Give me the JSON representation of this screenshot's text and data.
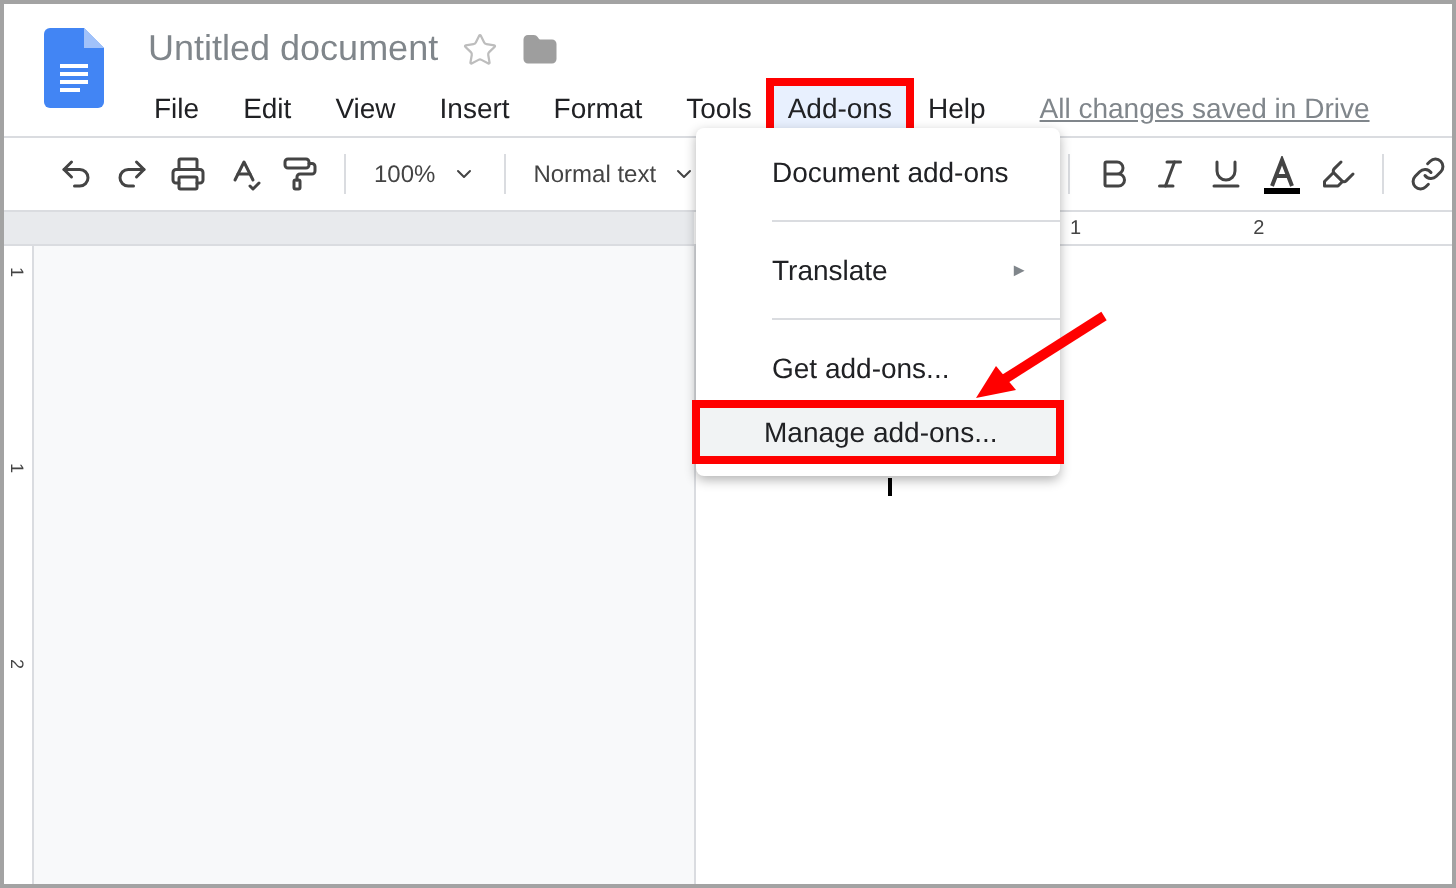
{
  "document": {
    "title": "Untitled document",
    "starred": false
  },
  "menu_bar": [
    {
      "label": "File",
      "selected": false,
      "annotated": false
    },
    {
      "label": "Edit",
      "selected": false,
      "annotated": false
    },
    {
      "label": "View",
      "selected": false,
      "annotated": false
    },
    {
      "label": "Insert",
      "selected": false,
      "annotated": false
    },
    {
      "label": "Format",
      "selected": false,
      "annotated": false
    },
    {
      "label": "Tools",
      "selected": false,
      "annotated": false
    },
    {
      "label": "Add-ons",
      "selected": true,
      "annotated": true
    },
    {
      "label": "Help",
      "selected": false,
      "annotated": false
    }
  ],
  "save_status": "All changes saved in Drive",
  "toolbar": {
    "zoom": "100%",
    "style": "Normal text"
  },
  "ruler": {
    "horizontal_labels": [
      "1",
      "2"
    ],
    "vertical_labels": [
      "1",
      "1",
      "2"
    ]
  },
  "dropdown": {
    "groups": [
      [
        {
          "label": "Document add-ons",
          "kind": "item",
          "highlighted": false,
          "annotated": false
        }
      ],
      [
        {
          "label": "Translate",
          "kind": "submenu",
          "arrow": "►",
          "highlighted": false,
          "annotated": false
        }
      ],
      [
        {
          "label": "Get add-ons...",
          "kind": "item",
          "highlighted": false,
          "annotated": false
        },
        {
          "label": "Manage add-ons...",
          "kind": "item",
          "highlighted": true,
          "annotated": true
        }
      ]
    ]
  }
}
